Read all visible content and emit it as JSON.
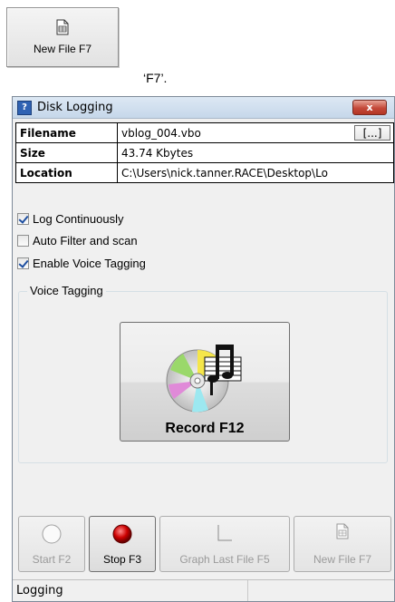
{
  "top_button": {
    "label": "New File F7"
  },
  "caption": "‘F7’.",
  "window": {
    "title": "Disk Logging",
    "close_glyph": "x",
    "info": {
      "filename_key": "Filename",
      "filename_value": "vblog_004.vbo",
      "browse_label": "[...]",
      "size_key": "Size",
      "size_value": "43.74 Kbytes",
      "location_key": "Location",
      "location_value": "C:\\Users\\nick.tanner.RACE\\Desktop\\Lo"
    },
    "checkboxes": [
      {
        "label": "Log Continuously",
        "checked": true
      },
      {
        "label": "Auto Filter and scan",
        "checked": false
      },
      {
        "label": "Enable Voice Tagging",
        "checked": true
      }
    ],
    "voice_tagging": {
      "legend": "Voice Tagging",
      "record_label": "Record F12"
    },
    "buttons": {
      "start": "Start F2",
      "stop": "Stop F3",
      "graph": "Graph Last File F5",
      "newfile": "New File F7"
    },
    "status": "Logging"
  },
  "colors": {
    "stop_led": "#cc0000",
    "accent": "#2f62b3"
  }
}
